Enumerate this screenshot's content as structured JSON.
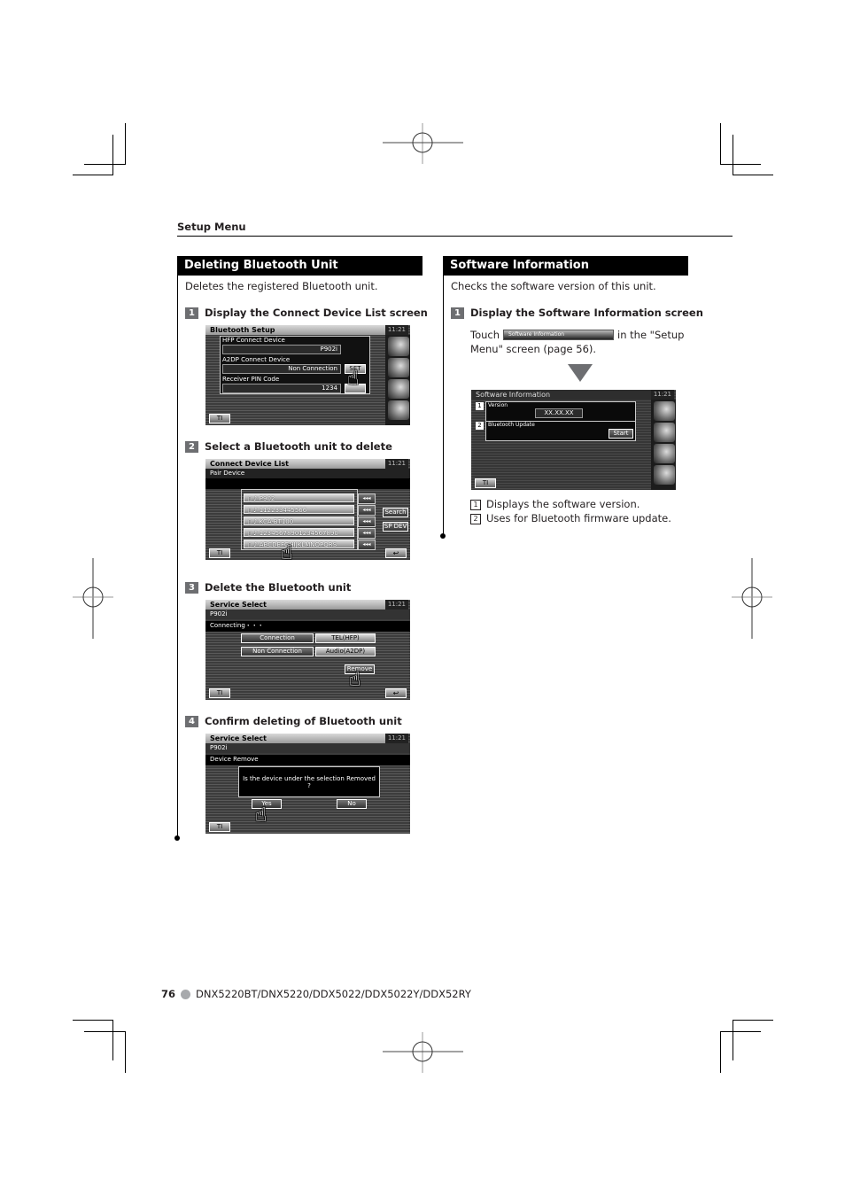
{
  "header": {
    "section_label": "Setup Menu"
  },
  "left": {
    "title": "Deleting Bluetooth Unit",
    "description": "Deletes the registered Bluetooth unit.",
    "steps": [
      {
        "num": "1",
        "label": "Display the Connect Device List screen"
      },
      {
        "num": "2",
        "label": "Select a Bluetooth unit to delete"
      },
      {
        "num": "3",
        "label": "Delete the Bluetooth unit"
      },
      {
        "num": "4",
        "label": "Confirm deleting of Bluetooth unit"
      }
    ],
    "screen1": {
      "title": "Bluetooth Setup",
      "clock": "11:21",
      "hfp_label": "HFP Connect Device",
      "hfp_value": "P902i",
      "a2dp_label": "A2DP Connect Device",
      "a2dp_value": "Non Connection",
      "set_button": "SET",
      "pin_label": "Receiver PIN Code",
      "pin_value": "1234",
      "ti_button": "TI"
    },
    "screen2": {
      "title": "Connect Device List",
      "clock": "11:21",
      "subtitle": "Pair Device",
      "devices": [
        "P902",
        "112233445566",
        "KCA-BT100",
        "12345678901234567890",
        "ABCDEFGHIJKLMNOPQRS"
      ],
      "arrow_label": "◂◂◂",
      "search_button": "Search",
      "spdev_button": "SP DEV",
      "ti_button": "TI",
      "back_icon": "return-icon"
    },
    "screen3": {
      "title": "Service Select",
      "clock": "11:21",
      "device": "P902i",
      "status": "Connecting・・・",
      "rows": [
        {
          "state": "Connection",
          "service": "TEL(HFP)"
        },
        {
          "state": "Non Connection",
          "service": "Audio(A2DP)"
        }
      ],
      "remove_button": "Remove",
      "ti_button": "TI"
    },
    "screen4": {
      "title": "Service Select",
      "clock": "11:21",
      "device": "P902i",
      "status": "Device Remove",
      "question": "Is the device under the selection Removed",
      "question_mark": "?",
      "yes_button": "Yes",
      "no_button": "No",
      "ti_button": "TI"
    }
  },
  "right": {
    "title": "Software Information",
    "description": "Checks the software version of this unit.",
    "step1": {
      "num": "1",
      "label": "Display the Software Information screen"
    },
    "instruction_prefix": "Touch",
    "inline_button": "Software Information",
    "instruction_suffix": "in the \"Setup",
    "instruction_line2": "Menu\" screen (page 56).",
    "screen": {
      "title": "Software Information",
      "clock": "11:21",
      "version_num": "1",
      "version_label": "Version",
      "version_value": "XX.XX.XX",
      "bt_num": "2",
      "bt_label": "Bluetooth Update",
      "start_button": "Start",
      "ti_button": "TI"
    },
    "notes": [
      {
        "num": "1",
        "text": "Displays the software version."
      },
      {
        "num": "2",
        "text": "Uses for Bluetooth firmware update."
      }
    ]
  },
  "footer": {
    "page_number": "76",
    "models": "DNX5220BT/DNX5220/DDX5022/DDX5022Y/DDX52RY"
  }
}
